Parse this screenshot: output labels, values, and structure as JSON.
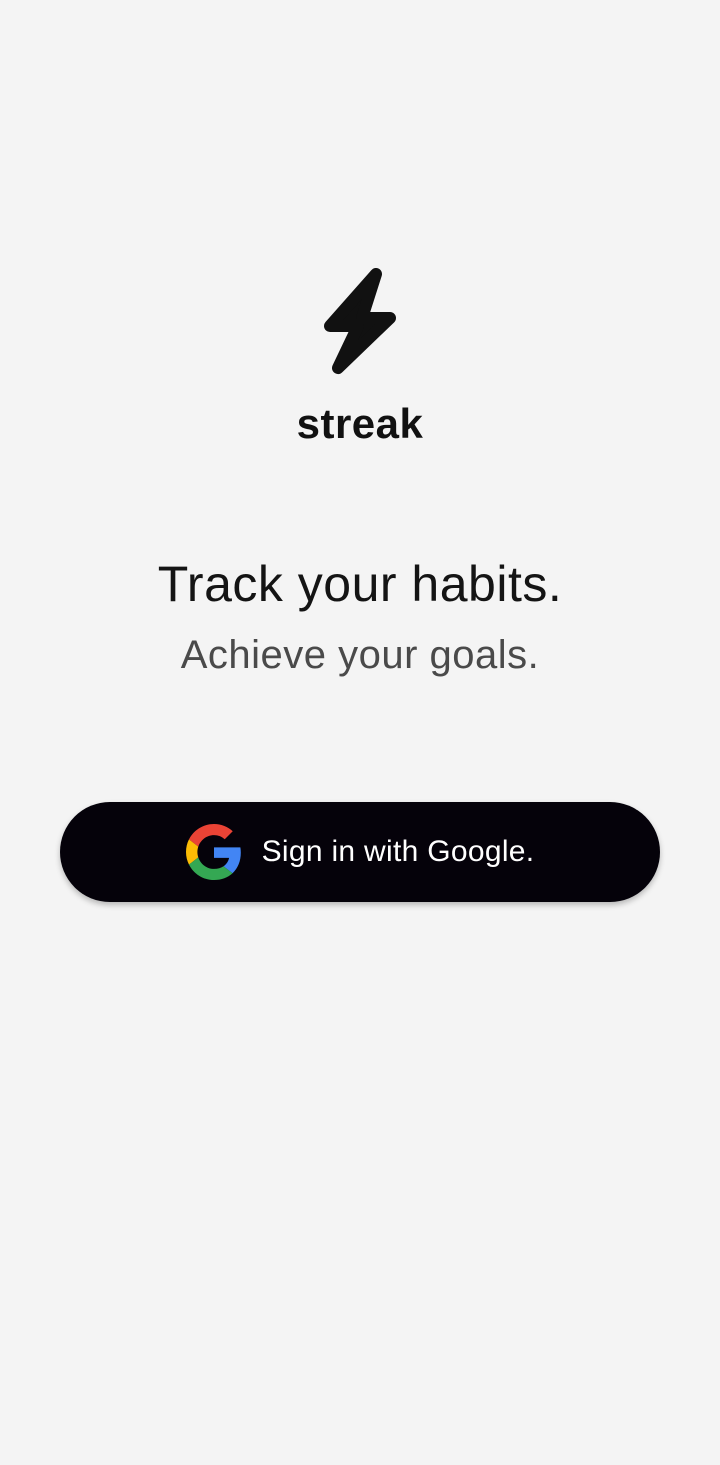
{
  "logo": {
    "icon": "lightning-bolt-icon",
    "brand": "streak"
  },
  "hero": {
    "headline": "Track your habits.",
    "subheadline": "Achieve your goals."
  },
  "signin": {
    "label": "Sign in with Google.",
    "icon": "google-icon"
  },
  "colors": {
    "background": "#f4f4f4",
    "button": "#05020a",
    "button_text": "#ffffff",
    "google_red": "#EA4335",
    "google_yellow": "#FBBC05",
    "google_green": "#34A853",
    "google_blue": "#4285F4"
  }
}
